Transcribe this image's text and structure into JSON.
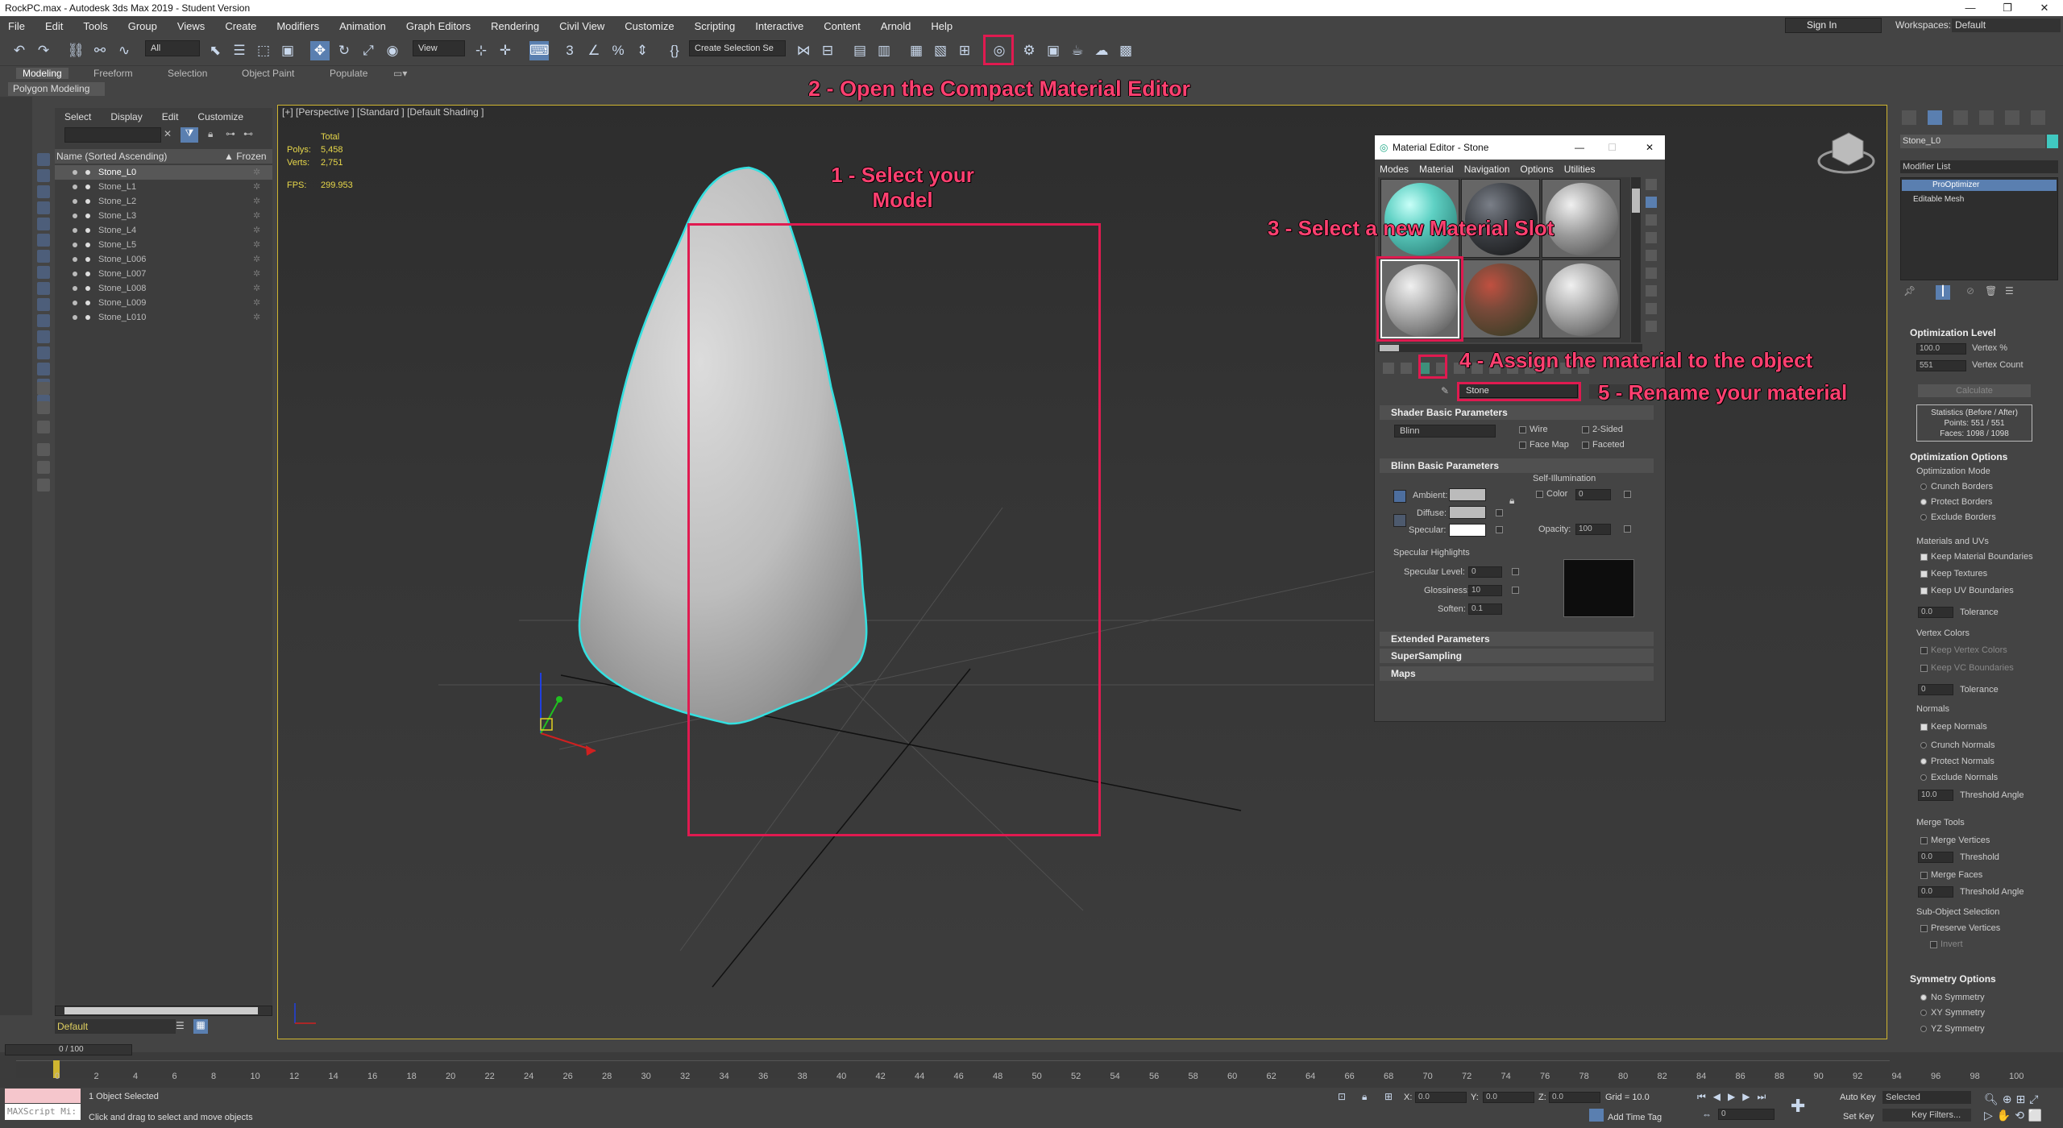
{
  "window": {
    "title": "RockPC.max - Autodesk 3ds Max 2019 - Student Version",
    "minimize": "—",
    "restore": "❐",
    "close": "✕"
  },
  "menu": [
    "File",
    "Edit",
    "Tools",
    "Group",
    "Views",
    "Create",
    "Modifiers",
    "Animation",
    "Graph Editors",
    "Rendering",
    "Civil View",
    "Customize",
    "Scripting",
    "Interactive",
    "Content",
    "Arnold",
    "Help"
  ],
  "account": {
    "signin": "Sign In",
    "workspaces_label": "Workspaces:",
    "workspace": "Default"
  },
  "toolbar": {
    "filter": "All",
    "view": "View",
    "selection_set": "Create Selection Se"
  },
  "ribbon": {
    "tabs": [
      "Modeling",
      "Freeform",
      "Selection",
      "Object Paint",
      "Populate"
    ],
    "sub": "Polygon Modeling"
  },
  "explorer": {
    "tabs": [
      "Select",
      "Display",
      "Edit",
      "Customize"
    ],
    "col_name": "Name (Sorted Ascending)",
    "col_frozen": "▲ Frozen",
    "items": [
      "Stone_L0",
      "Stone_L1",
      "Stone_L2",
      "Stone_L3",
      "Stone_L4",
      "Stone_L5",
      "Stone_L006",
      "Stone_L007",
      "Stone_L008",
      "Stone_L009",
      "Stone_L010"
    ],
    "layer": "Default"
  },
  "viewport": {
    "label": "[+] [Perspective ] [Standard ] [Default Shading ]",
    "stats": {
      "total": "Total",
      "polys_label": "Polys:",
      "polys": "5,458",
      "verts_label": "Verts:",
      "verts": "2,751",
      "fps_label": "FPS:",
      "fps": "299.953"
    }
  },
  "annotations": {
    "a1_line1": "1 - Select your",
    "a1_line2": "Model",
    "a2": "2 - Open the Compact Material Editor",
    "a3": "3 - Select a new Material Slot",
    "a4": "4 - Assign the material to the object",
    "a5": "5 - Rename your material"
  },
  "material_editor": {
    "title": "Material Editor - Stone",
    "menu": [
      "Modes",
      "Material",
      "Navigation",
      "Options",
      "Utilities"
    ],
    "name": "Stone",
    "shader_basic": "Shader Basic Parameters",
    "shader": "Blinn",
    "wire": "Wire",
    "two_sided": "2-Sided",
    "face_map": "Face Map",
    "faceted": "Faceted",
    "blinn_basic": "Blinn Basic Parameters",
    "self_illum": "Self-Illumination",
    "color": "Color",
    "color_val": "0",
    "ambient": "Ambient:",
    "diffuse": "Diffuse:",
    "specular": "Specular:",
    "opacity": "Opacity:",
    "opacity_val": "100",
    "spec_highlights": "Specular Highlights",
    "spec_level": "Specular Level:",
    "spec_level_val": "0",
    "glossiness": "Glossiness:",
    "gloss_val": "10",
    "soften": "Soften:",
    "soften_val": "0.1",
    "extended": "Extended Parameters",
    "supersampling": "SuperSampling",
    "maps": "Maps",
    "sphere_colors": [
      "#5fd1c4",
      "#3a3d42",
      "#9a9a9a",
      "#a5a5a5",
      "#7a4a3a",
      "#a5a5a5"
    ]
  },
  "command_panel": {
    "object_name": "Stone_L0",
    "modifier_list": "Modifier List",
    "stack": [
      "ProOptimizer",
      "Editable Mesh"
    ],
    "opt_level": "Optimization Level",
    "vertex_pct": "100.0",
    "vertex_pct_label": "Vertex %",
    "vertex_count": "551",
    "vertex_count_label": "Vertex Count",
    "calculate": "Calculate",
    "stats_title": "Statistics (Before / After)",
    "stats_points": "Points: 551 / 551",
    "stats_faces": "Faces: 1098 / 1098",
    "opt_options": "Optimization Options",
    "opt_mode": "Optimization Mode",
    "crunch_borders": "Crunch Borders",
    "protect_borders": "Protect Borders",
    "exclude_borders": "Exclude Borders",
    "mat_uvs": "Materials and UVs",
    "keep_mat_bounds": "Keep Material Boundaries",
    "keep_textures": "Keep Textures",
    "keep_uv_bounds": "Keep UV Boundaries",
    "tolerance": "Tolerance",
    "tol_val": "0.0",
    "vertex_colors": "Vertex Colors",
    "keep_vertex_colors": "Keep Vertex Colors",
    "keep_vc_bounds": "Keep VC Boundaries",
    "tol_val2": "0",
    "normals": "Normals",
    "keep_normals": "Keep Normals",
    "crunch_normals": "Crunch Normals",
    "protect_normals": "Protect Normals",
    "exclude_normals": "Exclude Normals",
    "threshold_angle": "Threshold Angle",
    "thr_val": "10.0",
    "merge_tools": "Merge Tools",
    "merge_vertices": "Merge Vertices",
    "threshold": "Threshold",
    "merge_faces": "Merge Faces",
    "mv_val": "0.0",
    "mf_val": "0.0",
    "subobj": "Sub-Object Selection",
    "preserve_vertices": "Preserve Vertices",
    "invert": "Invert",
    "symmetry": "Symmetry Options",
    "no_sym": "No Symmetry",
    "xy_sym": "XY Symmetry",
    "yz_sym": "YZ Symmetry"
  },
  "timeline": {
    "frame": "0 / 100",
    "ticks": [
      "0",
      "2",
      "4",
      "6",
      "8",
      "10",
      "12",
      "14",
      "16",
      "18",
      "20",
      "22",
      "24",
      "26",
      "28",
      "30",
      "32",
      "34",
      "36",
      "38",
      "40",
      "42",
      "44",
      "46",
      "48",
      "50",
      "52",
      "54",
      "56",
      "58",
      "60",
      "62",
      "64",
      "66",
      "68",
      "70",
      "72",
      "74",
      "76",
      "78",
      "80",
      "82",
      "84",
      "86",
      "88",
      "90",
      "92",
      "94",
      "96",
      "98",
      "100"
    ]
  },
  "status": {
    "selected": "1 Object Selected",
    "prompt": "Click and drag to select and move objects",
    "maxscript": "MAXScript Mi:",
    "x_label": "X:",
    "x": "0.0",
    "y_label": "Y:",
    "y": "0.0",
    "z_label": "Z:",
    "z": "0.0",
    "grid": "Grid = 10.0",
    "add_time_tag": "Add Time Tag",
    "auto_key": "Auto Key",
    "set_key": "Set Key",
    "selected_combo": "Selected",
    "key_filters": "Key Filters...",
    "frame_field": "0"
  }
}
